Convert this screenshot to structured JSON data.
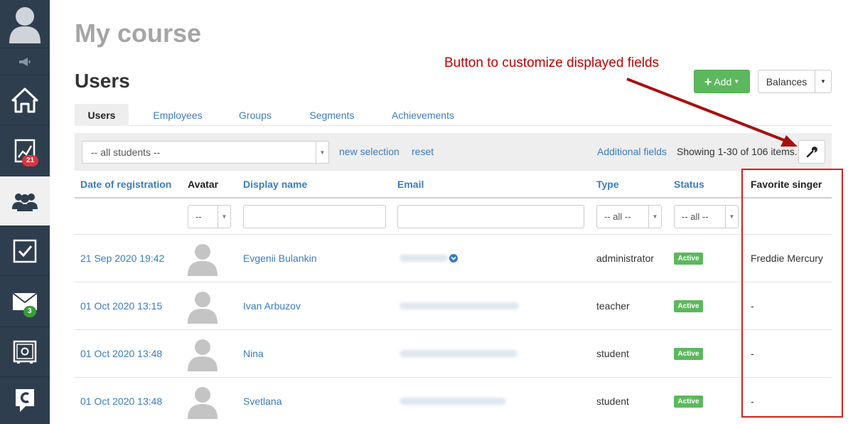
{
  "sidebar": {
    "progress_badge": "21",
    "mail_badge": "3",
    "badge_colors": {
      "progress": "#d9363e",
      "mail": "#3a9d3a"
    }
  },
  "page": {
    "title": "My course",
    "section_title": "Users",
    "annotation": "Button to customize displayed fields"
  },
  "toolbar": {
    "add_label": "Add",
    "balances_label": "Balances"
  },
  "tabs": [
    {
      "label": "Users",
      "active": true
    },
    {
      "label": "Employees"
    },
    {
      "label": "Groups"
    },
    {
      "label": "Segments"
    },
    {
      "label": "Achievements"
    }
  ],
  "filterbar": {
    "students_select": "-- all students --",
    "new_selection": "new selection",
    "reset": "reset",
    "additional_fields": "Additional fields",
    "showing": "Showing 1-30 of 106 items."
  },
  "table": {
    "headers": [
      "Date of registration",
      "Avatar",
      "Display name",
      "Email",
      "Type",
      "Status",
      "Favorite singer"
    ],
    "filters": {
      "avatar": "--",
      "type": "-- all --",
      "status": "-- all --"
    },
    "rows": [
      {
        "date": "21 Sep 2020 19:42",
        "name": "Evgenii Bulankin",
        "type": "administrator",
        "status": "Active",
        "singer": "Freddie Mercury"
      },
      {
        "date": "01 Oct 2020 13:15",
        "name": "Ivan Arbuzov",
        "type": "teacher",
        "status": "Active",
        "singer": "-"
      },
      {
        "date": "01 Oct 2020 13:48",
        "name": "Nina",
        "type": "student",
        "status": "Active",
        "singer": "-"
      },
      {
        "date": "01 Oct 2020 13:48",
        "name": "Svetlana",
        "type": "student",
        "status": "Active",
        "singer": "-"
      }
    ]
  },
  "colors": {
    "accent": "#3b7bbf",
    "success": "#5cb85c",
    "annotation": "#c00000",
    "sidebar": "#2f3e4e"
  }
}
